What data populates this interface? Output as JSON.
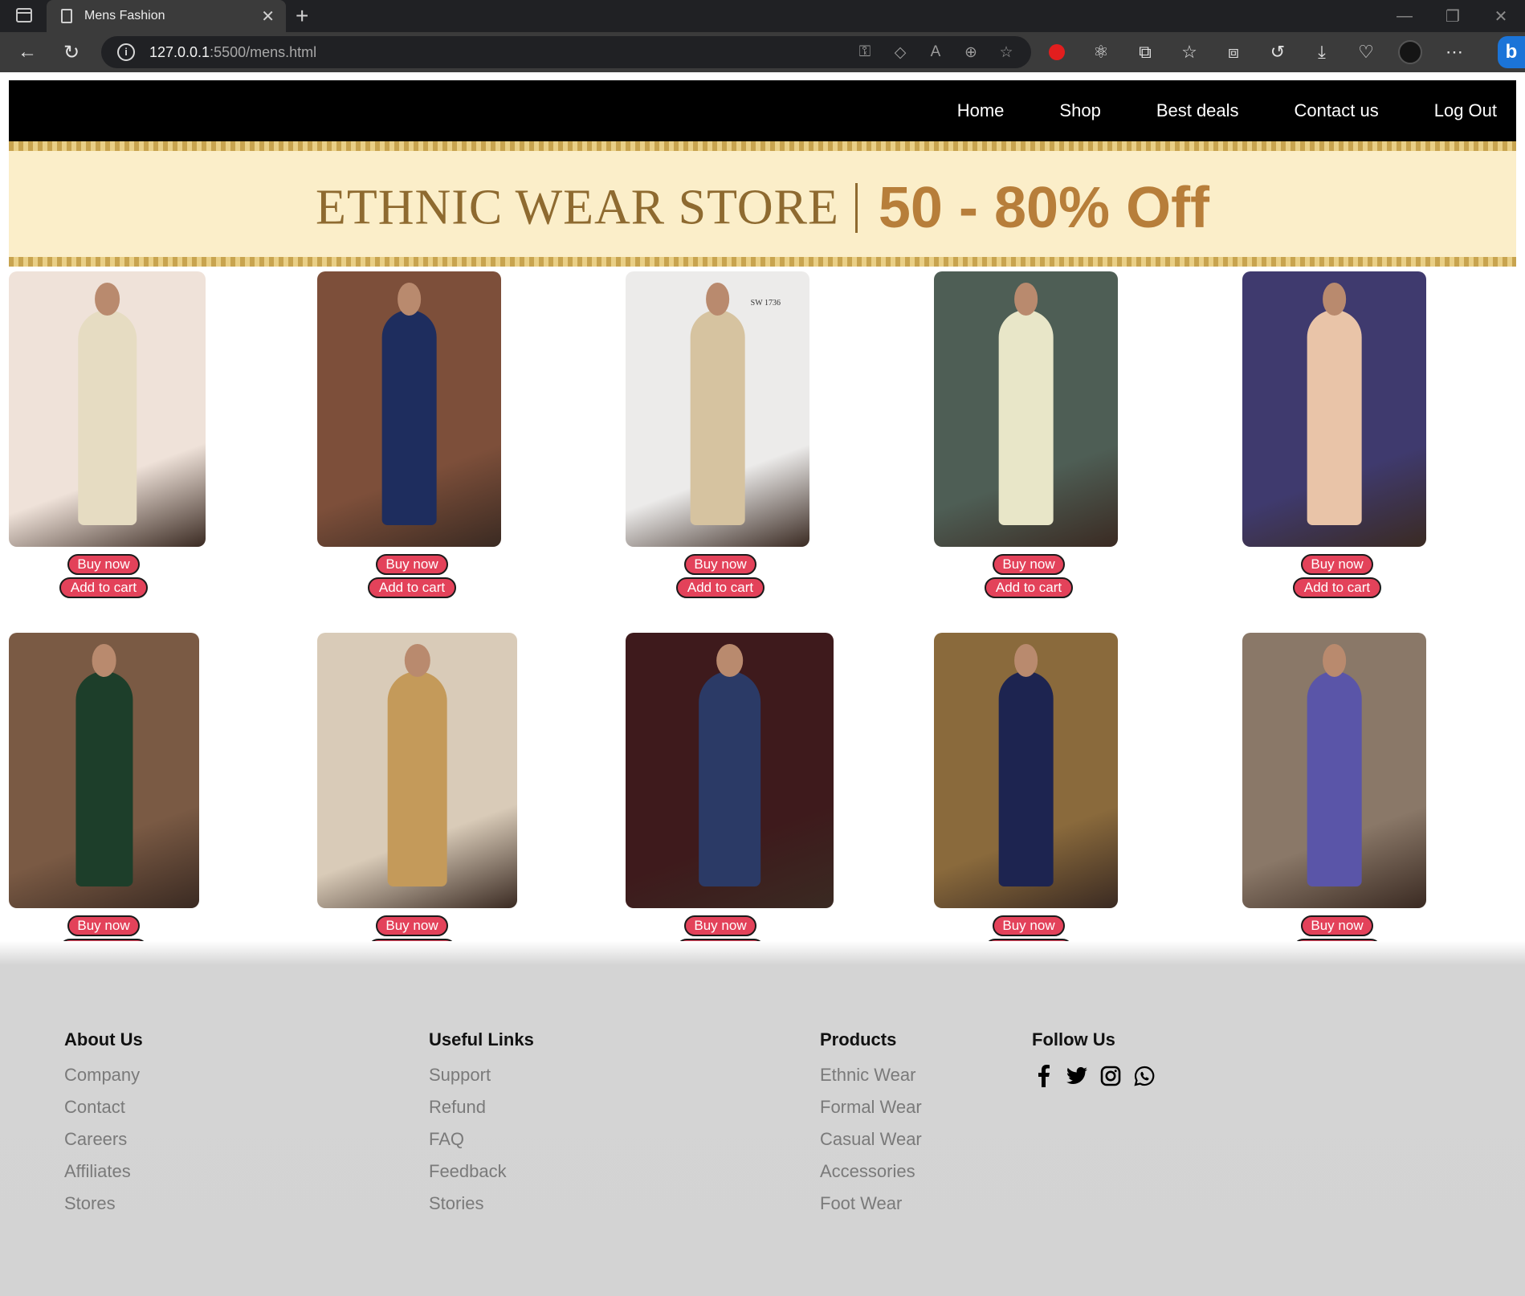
{
  "browser": {
    "tab_title": "Mens Fashion",
    "url_host": "127.0.0.1",
    "url_rest": ":5500/mens.html"
  },
  "nav": {
    "items": [
      {
        "label": "Home"
      },
      {
        "label": "Shop"
      },
      {
        "label": "Best deals"
      },
      {
        "label": "Contact us"
      },
      {
        "label": "Log Out"
      }
    ]
  },
  "banner": {
    "store_text": "ETHNIC WEAR STORE",
    "discount_text": "50 - 80% Off"
  },
  "buttons": {
    "buy_label": "Buy now",
    "cart_label": "Add to cart"
  },
  "products": [
    {
      "watermark": ""
    },
    {
      "watermark": ""
    },
    {
      "watermark": "SW 1736"
    },
    {
      "watermark": ""
    },
    {
      "watermark": ""
    },
    {
      "watermark": ""
    },
    {
      "watermark": ""
    },
    {
      "watermark": ""
    },
    {
      "watermark": ""
    },
    {
      "watermark": ""
    }
  ],
  "footer": {
    "about": {
      "heading": "About Us",
      "links": [
        "Company",
        "Contact",
        "Careers",
        "Affiliates",
        "Stores"
      ]
    },
    "useful": {
      "heading": "Useful Links",
      "links": [
        "Support",
        "Refund",
        "FAQ",
        "Feedback",
        "Stories"
      ]
    },
    "products": {
      "heading": "Products",
      "links": [
        "Ethnic Wear",
        "Formal Wear",
        "Casual Wear",
        "Accessories",
        "Foot Wear"
      ]
    },
    "follow": {
      "heading": "Follow Us",
      "icons": [
        "facebook-icon",
        "twitter-icon",
        "instagram-icon",
        "whatsapp-icon"
      ]
    }
  },
  "colors": {
    "navbar": "#000000",
    "button": "#e3425a",
    "footer": "#d3d3d3",
    "banner": "#fbeec9"
  }
}
